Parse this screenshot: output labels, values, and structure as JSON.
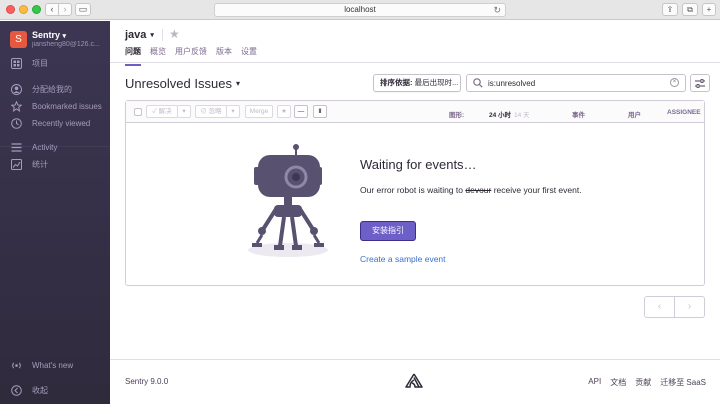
{
  "browser": {
    "url": "localhost"
  },
  "sidebar": {
    "org_initial": "S",
    "org_name": "Sentry",
    "org_email": "jiansheng80@126.c...",
    "items": [
      {
        "label": "项目",
        "icon": "projects-icon"
      },
      {
        "label": "分配给我的",
        "icon": "user-icon"
      },
      {
        "label": "Bookmarked issues",
        "icon": "star-icon"
      },
      {
        "label": "Recently viewed",
        "icon": "clock-icon"
      },
      {
        "label": "Activity",
        "icon": "activity-icon"
      },
      {
        "label": "统计",
        "icon": "stats-icon"
      }
    ],
    "whats_new": "What's new",
    "collapse": "收起"
  },
  "header": {
    "project": "java",
    "tabs": [
      {
        "label": "问题",
        "active": true
      },
      {
        "label": "概览",
        "active": false
      },
      {
        "label": "用户反馈",
        "active": false
      },
      {
        "label": "版本",
        "active": false
      },
      {
        "label": "设置",
        "active": false
      }
    ]
  },
  "issues": {
    "title": "Unresolved Issues",
    "sort_label": "排序依据:",
    "sort_value": "最后出现时...",
    "search_value": "is:unresolved"
  },
  "toolbar": {
    "resolve": "✓ 解决",
    "ignore": "⊘ 忽略",
    "merge": "Merge",
    "col_graph": "图形:",
    "col_24h": "24 小时",
    "col_14d": "14 天",
    "col_events": "事件",
    "col_users": "用户",
    "col_assignee": "ASSIGNEE"
  },
  "empty_state": {
    "title": "Waiting for events…",
    "desc_before": "Our error robot is waiting to ",
    "desc_strike": "devour",
    "desc_after": " receive your first event.",
    "install_button": "安装指引",
    "sample_link": "Create a sample event"
  },
  "footer": {
    "version": "Sentry 9.0.0",
    "links": [
      "API",
      "文档",
      "贡献",
      "迁移至 SaaS"
    ]
  },
  "colors": {
    "accent": "#6c5fc7",
    "sidebar_bg": "#3c3653",
    "link": "#3b6ecc"
  }
}
